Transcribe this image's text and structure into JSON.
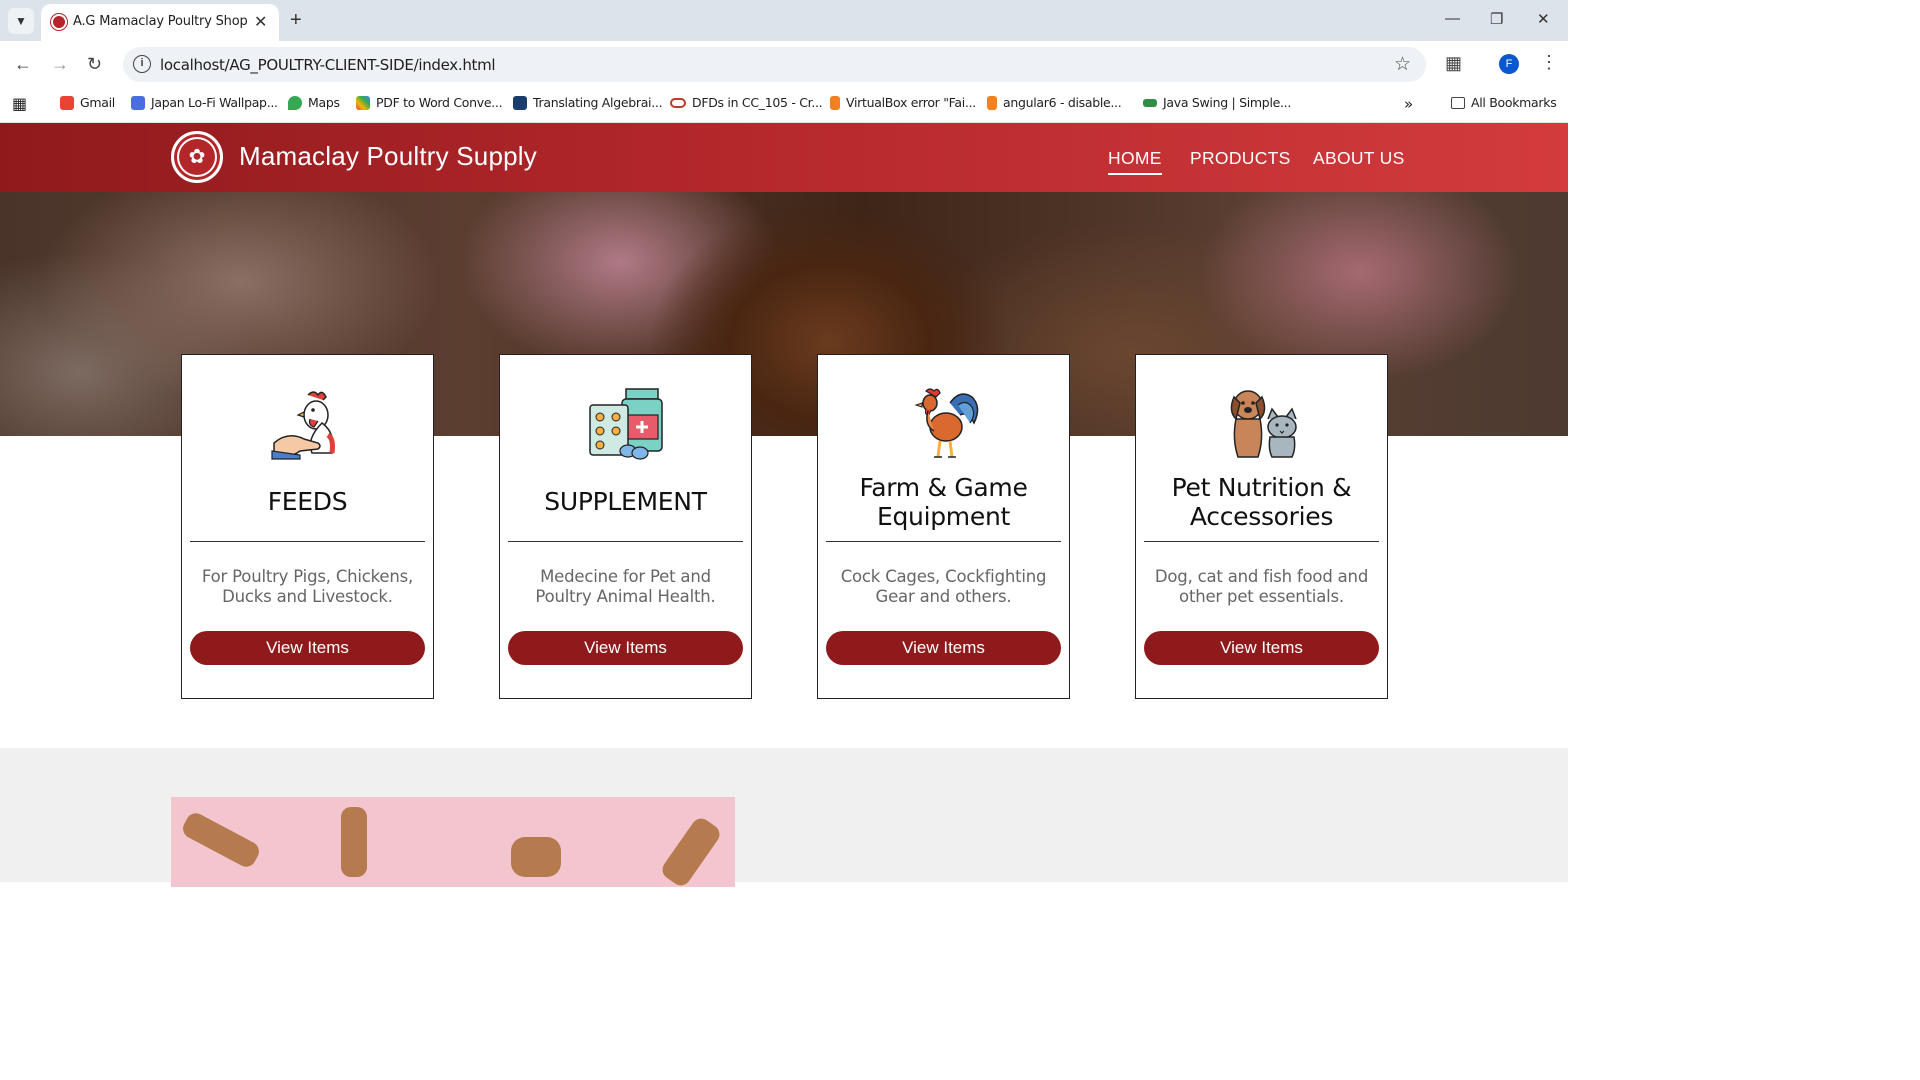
{
  "browser": {
    "tab_title": "A.G Mamaclay Poultry Shop",
    "url": "localhost/AG_POULTRY-CLIENT-SIDE/index.html",
    "profile_initial": "F",
    "bookmarks": [
      {
        "label": "Gmail",
        "icon": "gmail-icon",
        "color": "#ea4335"
      },
      {
        "label": "Japan Lo-Fi Wallpap...",
        "icon": "wallpaper-icon",
        "color": "#4a6ee0"
      },
      {
        "label": "Maps",
        "icon": "maps-icon",
        "color": "#34a853"
      },
      {
        "label": "PDF to Word Conve...",
        "icon": "pdf-icon",
        "color": "#f4b400"
      },
      {
        "label": "Translating Algebrai...",
        "icon": "translate-icon",
        "color": "#1a3d6d"
      },
      {
        "label": "DFDs in CC_105 - Cr...",
        "icon": "link-icon",
        "color": "#c0392b"
      },
      {
        "label": "VirtualBox error \"Fai...",
        "icon": "stackoverflow-icon",
        "color": "#f48024"
      },
      {
        "label": "angular6 - disable...",
        "icon": "stackoverflow-icon",
        "color": "#f48024"
      },
      {
        "label": "Java Swing | Simple...",
        "icon": "geeks-icon",
        "color": "#2f8d46"
      }
    ],
    "all_bookmarks": "All Bookmarks"
  },
  "header": {
    "brand": "Mamaclay Poultry Supply",
    "nav": [
      "HOME",
      "PRODUCTS",
      "ABOUT US"
    ],
    "active_nav": "HOME"
  },
  "cards": [
    {
      "title": "FEEDS",
      "desc": "For Poultry Pigs, Chickens, Ducks and Livestock.",
      "button": "View Items",
      "icon": "chicken-in-hand-icon"
    },
    {
      "title": "SUPPLEMENT",
      "desc": "Medecine for Pet and Poultry Animal Health.",
      "button": "View Items",
      "icon": "medicine-icon"
    },
    {
      "title": "Farm & Game Equipment",
      "desc": "Cock Cages, Cockfighting Gear and others.",
      "button": "View Items",
      "icon": "rooster-icon"
    },
    {
      "title": "Pet Nutrition & Accessories",
      "desc": "Dog, cat and fish food and other pet essentials.",
      "button": "View Items",
      "icon": "dog-and-cat-icon"
    }
  ],
  "colors": {
    "header_dark": "#8f1a1c",
    "header_light": "#d33b3d",
    "button": "#8e1a1b",
    "gray_section": "#f0f0f0"
  }
}
